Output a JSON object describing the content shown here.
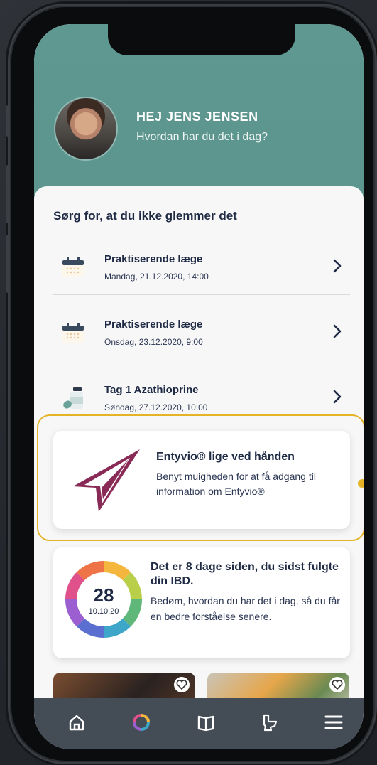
{
  "greeting": {
    "name": "HEJ JENS JENSEN",
    "subtitle": "Hvordan har du det i dag?"
  },
  "reminders": {
    "section_title": "Sørg for, at du ikke glemmer det",
    "items": [
      {
        "title": "Praktiserende læge",
        "date": "Mandag, 21.12.2020, 14:00",
        "icon": "calendar-icon"
      },
      {
        "title": "Praktiserende læge",
        "date": "Onsdag, 23.12.2020, 9:00",
        "icon": "calendar-icon"
      },
      {
        "title": "Tag 1 Azathioprine",
        "date": "Søndag, 27.12.2020, 10:00",
        "icon": "pill-bottle-icon"
      }
    ]
  },
  "promo": {
    "title": "Entyvio® lige ved hånden",
    "body": "Benyt muigheden for at få adgang til information om Entyvio®",
    "icon": "entyvio-logo"
  },
  "tracking": {
    "days": "28",
    "date": "10.10.20",
    "title": "Det er 8 dage siden, du sidst fulgte din IBD.",
    "body": "Bedøm, hvordan du har det i dag, så du får en bedre forståelse senere."
  },
  "tabs": [
    {
      "name": "home-icon"
    },
    {
      "name": "mood-ring-icon"
    },
    {
      "name": "book-icon"
    },
    {
      "name": "toilet-icon"
    },
    {
      "name": "menu-icon"
    }
  ],
  "colors": {
    "header": "#5f9891",
    "highlight": "#e4b326",
    "text_dark": "#1f2a44",
    "tabbar": "#444c56",
    "brand": "#8a2a56"
  }
}
